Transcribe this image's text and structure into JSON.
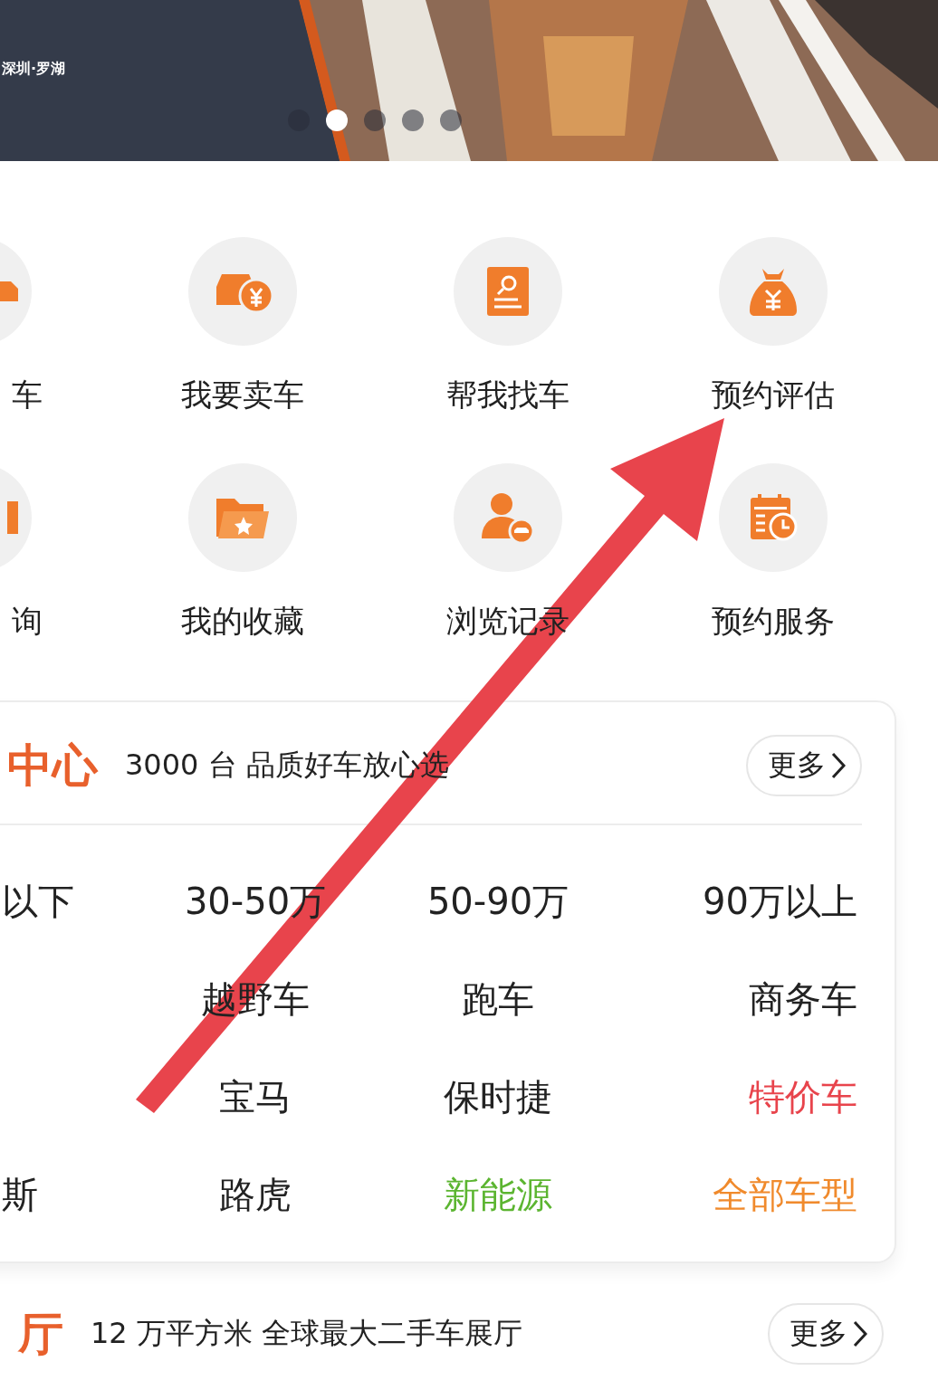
{
  "banner": {
    "location": "深圳·罗湖",
    "dots": [
      {
        "selected": false
      },
      {
        "selected": true
      },
      {
        "selected": false
      },
      {
        "selected": false
      },
      {
        "selected": false
      }
    ]
  },
  "services": [
    {
      "label": "车"
    },
    {
      "label": "我要卖车"
    },
    {
      "label": "帮我找车"
    },
    {
      "label": "预约评估"
    },
    {
      "label": "询"
    },
    {
      "label": "我的收藏"
    },
    {
      "label": "浏览记录"
    },
    {
      "label": "预约服务"
    }
  ],
  "center": {
    "title": "中心",
    "subtitle": "3000 台 品质好车放心选",
    "more": "更多",
    "filters": [
      [
        {
          "label": "以下"
        },
        {
          "label": "30-50万"
        },
        {
          "label": "50-90万"
        },
        {
          "label": "90万以上"
        }
      ],
      [
        {
          "label": "越野车"
        },
        {
          "label": "跑车"
        },
        {
          "label": "商务车"
        }
      ],
      [
        {
          "label": "宝马"
        },
        {
          "label": "保时捷"
        },
        {
          "label": "特价车",
          "color": "#e8444c"
        }
      ],
      [
        {
          "label": "斯"
        },
        {
          "label": "路虎"
        },
        {
          "label": "新能源",
          "color": "#5cb531"
        },
        {
          "label": "全部车型",
          "color": "#f08a2c"
        }
      ]
    ]
  },
  "showroom": {
    "title": "厅",
    "subtitle": "12 万平方米 全球最大二手车展厅",
    "more": "更多"
  }
}
